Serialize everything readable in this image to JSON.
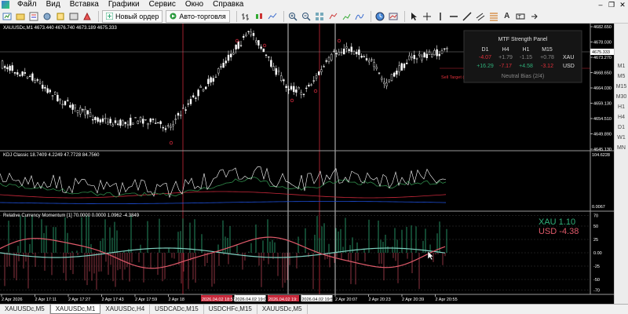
{
  "menu": {
    "items": [
      "Файл",
      "Вид",
      "Вставка",
      "Графики",
      "Сервис",
      "Окно",
      "Справка"
    ],
    "window_buttons": [
      "–",
      "❐",
      "✕"
    ]
  },
  "toolbar": {
    "new_order_label": "Новый ордер",
    "auto_trading_label": "Авто-торговля"
  },
  "chart": {
    "main_title": "XAUUSDc,M1  4673.440 4676.740 4673.189 4675.333",
    "price_axis": [
      "4682.650",
      "4678.030",
      "4673.270",
      "4668.650",
      "4664.030",
      "4659.130",
      "4654.510",
      "4649.890",
      "4645.130"
    ],
    "current_price": "4675.333",
    "target_label": "Sell Target (1) 4668.062",
    "indicator1_title": "KDJ Classic 18.7409 4.2249 47.7728 84.7560",
    "indicator1_axis": [
      "104.6228",
      "0.0067"
    ],
    "indicator2_title": "Relative Currency Momentum [1] 70.0000 0.0000 1.0962 -4.3849",
    "indicator2_axis": [
      "70",
      "50",
      "25",
      "0.00",
      "-25",
      "-50",
      "-70"
    ],
    "rcm_xau_label": "XAU  1.10",
    "rcm_usd_label": "USD -4.38",
    "time_axis": [
      "2 Apr 2026",
      "2 Apr 17:11",
      "2 Apr 17:27",
      "2 Apr 17:43",
      "2 Apr 17:59",
      "2 Apr 18",
      "2026.04.02 18:57",
      "2026.04.02 19:05",
      "2026.04.02 19:",
      "2026.04.02 19:57",
      "2 Apr 20:07",
      "2 Apr 20:23",
      "2 Apr 20:39",
      "2 Apr 20:55"
    ]
  },
  "panel": {
    "title": "MTF Strength Panel",
    "headers": [
      "D1",
      "H4",
      "H1",
      "M15"
    ],
    "rows": [
      {
        "values": [
          "-4.07",
          "+1.79",
          "-1.15",
          "+0.78"
        ],
        "label": "XAU"
      },
      {
        "values": [
          "+16.29",
          "-7.17",
          "+4.58",
          "-3.12"
        ],
        "label": "USD"
      }
    ],
    "footer": "Neutral Bias (2/4)"
  },
  "timeframes": [
    "M1",
    "M5",
    "M15",
    "M30",
    "H1",
    "H4",
    "D1",
    "W1",
    "MN"
  ],
  "tabs": [
    {
      "label": "XAUUSDc,M5",
      "active": false
    },
    {
      "label": "XAUUSDc,M1",
      "active": true
    },
    {
      "label": "XAUUSDc,H4",
      "active": false
    },
    {
      "label": "USDCADc,M15",
      "active": false
    },
    {
      "label": "USDCHFc,M15",
      "active": false
    },
    {
      "label": "XAUUSDc,M5",
      "active": false
    }
  ],
  "colors": {
    "bg": "#000000",
    "candle": "#ffffff",
    "accent_red": "#e0303a",
    "xau_green": "#2fb07a",
    "usd_red": "#e05a6a",
    "panel_bg": "#151515"
  }
}
